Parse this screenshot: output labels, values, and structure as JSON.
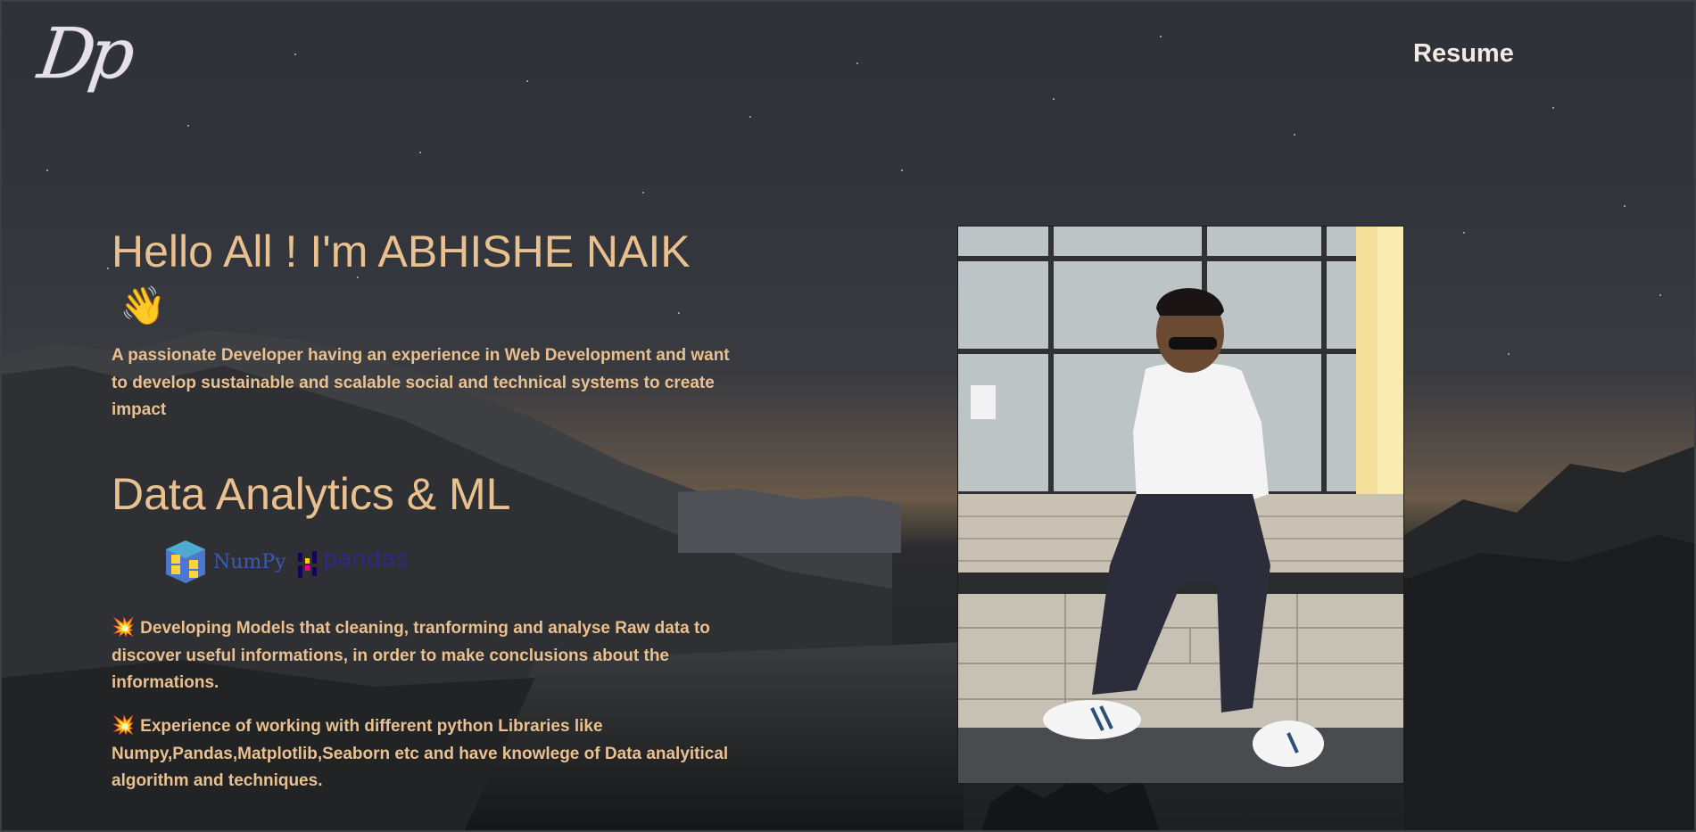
{
  "nav": {
    "logo_text": "Dp",
    "resume_label": "Resume"
  },
  "hero": {
    "greeting": "Hello All ! I'm ABHISHE NAIK",
    "wave_emoji": "👋",
    "intro": "A passionate Developer having an experience in Web Development and want to develop sustainable and scalable social and technical systems to create impact"
  },
  "section": {
    "title": "Data Analytics & ML",
    "tools": [
      {
        "name": "NumPy",
        "icon": "numpy-logo",
        "color": "#4d77cf"
      },
      {
        "name": "pandas",
        "icon": "pandas-logo",
        "color": "#150458"
      }
    ],
    "bullet_icon": "💥",
    "points": [
      "Developing Models that cleaning, tranforming and analyse Raw data to discover useful informations, in order to make conclusions about the informations.",
      "Experience of working with different python Libraries like Numpy,Pandas,Matplotlib,Seaborn etc and have knowlege of Data analyitical algorithm and techniques."
    ]
  },
  "colors": {
    "accent": "#e9c08f",
    "nav_text": "#f3eae4",
    "background": "#2e3137"
  }
}
